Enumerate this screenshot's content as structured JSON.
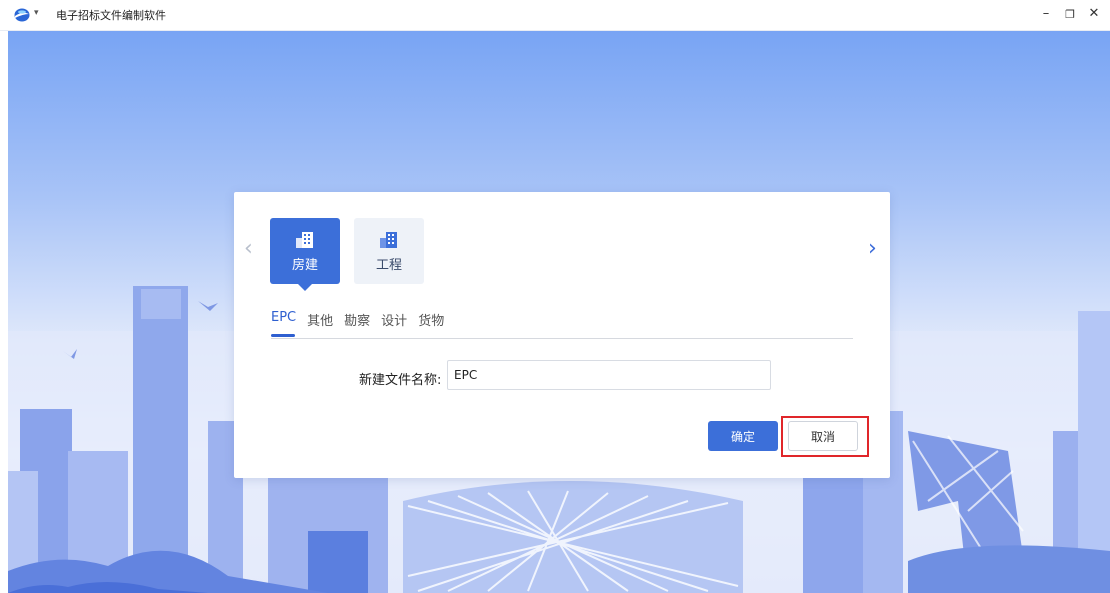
{
  "window": {
    "title": "电子招标文件编制软件",
    "controls": {
      "minimize": "–",
      "maximize": "❐",
      "close": "✕"
    }
  },
  "dialog": {
    "categories": [
      {
        "label": "房建",
        "icon": "building-icon",
        "active": true
      },
      {
        "label": "工程",
        "icon": "building-icon",
        "active": false
      }
    ],
    "tabs": [
      "EPC",
      "其他",
      "勘察",
      "设计",
      "货物"
    ],
    "active_tab": "EPC",
    "name_field": {
      "label": "新建文件名称:",
      "value": "EPC"
    },
    "buttons": {
      "confirm": "确定",
      "cancel": "取消"
    }
  },
  "colors": {
    "accent": "#3c6fd9",
    "highlight": "#e0262a"
  }
}
